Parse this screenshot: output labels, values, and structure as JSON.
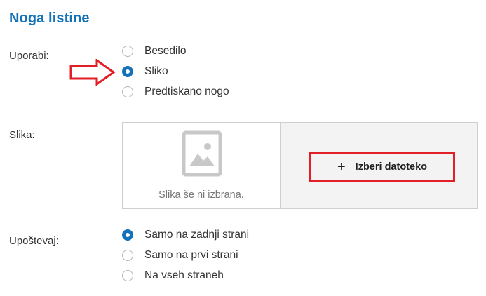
{
  "section": {
    "title": "Noga listine"
  },
  "use": {
    "label": "Uporabi:",
    "options": [
      {
        "label": "Besedilo",
        "checked": false
      },
      {
        "label": "Sliko",
        "checked": true
      },
      {
        "label": "Predtiskano nogo",
        "checked": false
      }
    ]
  },
  "image": {
    "label": "Slika:",
    "empty_text": "Slika še ni izbrana.",
    "choose_label": "Izberi datoteko",
    "choose_icon": "plus-icon",
    "placeholder_icon": "image-placeholder-icon"
  },
  "apply": {
    "label": "Upoštevaj:",
    "options": [
      {
        "label": "Samo na zadnji strani",
        "checked": true
      },
      {
        "label": "Samo na prvi strani",
        "checked": false
      },
      {
        "label": "Na vseh straneh",
        "checked": false
      }
    ]
  },
  "colors": {
    "accent": "#1473b8",
    "highlight": "#e21e26"
  },
  "annotation": {
    "arrow_icon": "red-arrow-icon",
    "highlight_target": "Izberi datoteko"
  }
}
